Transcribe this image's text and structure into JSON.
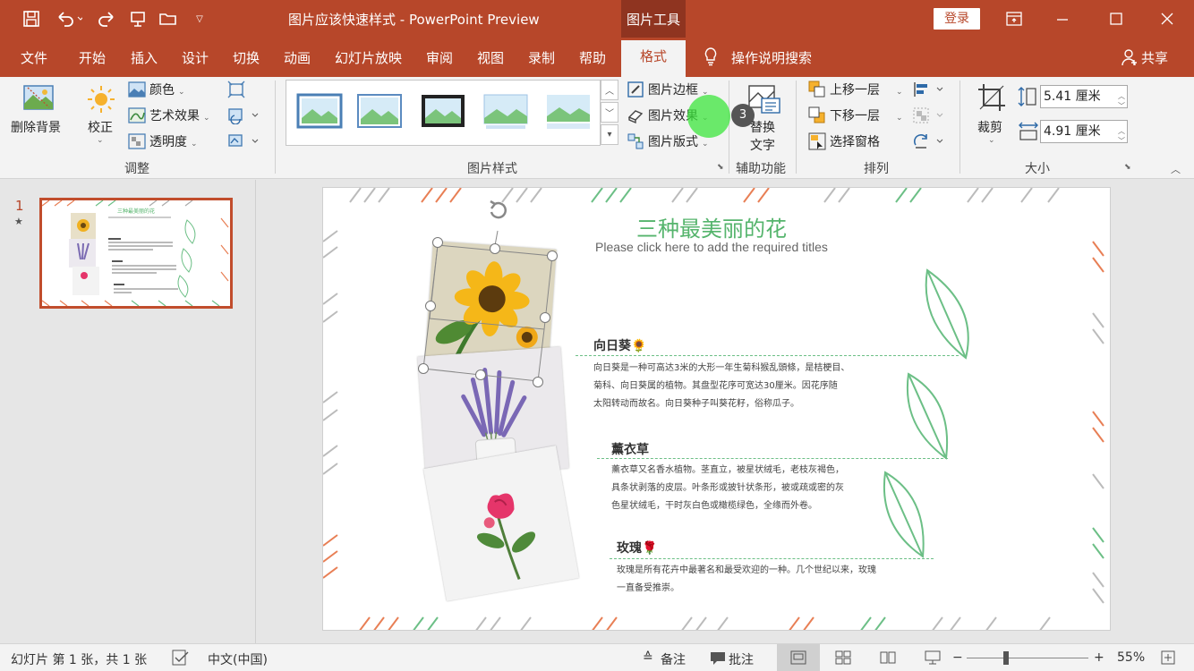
{
  "window": {
    "title": "图片应该快速样式 - PowerPoint Preview",
    "context_tab_group": "图片工具",
    "login_label": "登录"
  },
  "tabs": [
    "文件",
    "开始",
    "插入",
    "设计",
    "切换",
    "动画",
    "幻灯片放映",
    "审阅",
    "视图",
    "录制",
    "帮助",
    "格式"
  ],
  "active_tab": "格式",
  "tell_me": "操作说明搜索",
  "share_label": "共享",
  "ribbon": {
    "adjust": {
      "remove_bg": "删除背景",
      "correct": "校正",
      "color": "颜色",
      "art_effects": "艺术效果",
      "transparency": "透明度",
      "group_label": "调整"
    },
    "styles": {
      "border": "图片边框",
      "effects": "图片效果",
      "layout": "图片版式",
      "group_label": "图片样式"
    },
    "accessibility": {
      "alt_text_line1": "替换",
      "alt_text_line2": "文字",
      "group_label": "辅助功能"
    },
    "arrange": {
      "bring_forward": "上移一层",
      "send_backward": "下移一层",
      "selection_pane": "选择窗格",
      "group_label": "排列"
    },
    "size": {
      "crop": "裁剪",
      "height": "5.41 厘米",
      "width": "4.91 厘米",
      "group_label": "大小"
    },
    "step_badge": "3"
  },
  "thumbnails": {
    "slide_number": "1",
    "star": "★"
  },
  "slide": {
    "title": "三种最美丽的花",
    "subtitle": "Please click here to add the required titles",
    "sections": [
      {
        "heading": "向日葵🌻",
        "lines": [
          "向日葵是一种可高达3米的大形一年生菊科猴乱頭條，是桔梗目、",
          "菊科、向日葵属的植物。其盘型花序可宽达30厘米。因花序随",
          "太阳转动而故名。向日葵种子叫葵花籽，俗称瓜子。"
        ]
      },
      {
        "heading": "薰衣草",
        "lines": [
          "薰衣草又名香水植物。茎直立，被星状绒毛，老枝灰褐色，",
          "具条状剥落的皮层。叶条形或披针状条形，被或疏或密的灰",
          "色星状绒毛，干时灰白色或橄榄绿色，全缘而外卷。"
        ]
      },
      {
        "heading": "玫瑰🌹",
        "lines": [
          "玫瑰是所有花卉中最著名和最受欢迎的一种。几个世纪以来，玫瑰",
          "一直备受推崇。"
        ]
      }
    ]
  },
  "statusbar": {
    "slide_info": "幻灯片 第 1 张，共 1 张",
    "language": "中文(中国)",
    "notes": "备注",
    "comments": "批注",
    "zoom": "55%"
  },
  "colors": {
    "accent": "#b7472a",
    "title_green": "#55b46c"
  }
}
